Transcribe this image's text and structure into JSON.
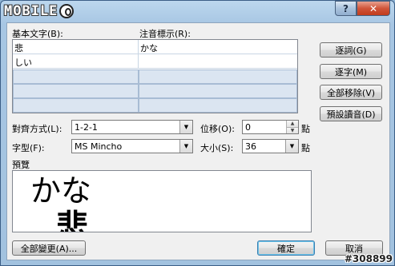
{
  "titlebar": {
    "logo_text": "MOBILE",
    "help_label": "?",
    "close_label": "✕"
  },
  "columns": {
    "base_label": "基本文字(B):",
    "ruby_label": "注音標示(R):"
  },
  "rows": [
    {
      "base": "悲",
      "ruby": "かな"
    },
    {
      "base": "しい",
      "ruby": ""
    }
  ],
  "side_buttons": {
    "group": "逐詞(G)",
    "mono": "逐字(M)",
    "clear": "全部移除(V)",
    "default_reading": "預設讀音(D)"
  },
  "alignment": {
    "label": "對齊方式(L):",
    "value": "1-2-1"
  },
  "offset": {
    "label": "位移(O):",
    "value": "0",
    "unit": "點"
  },
  "font": {
    "label": "字型(F):",
    "value": "MS Mincho"
  },
  "size": {
    "label": "大小(S):",
    "value": "36",
    "unit": "點"
  },
  "preview": {
    "label": "預覽",
    "ruby_text": "かな",
    "base_text": "悲"
  },
  "footer": {
    "apply_all": "全部變更(A)...",
    "ok": "確定",
    "cancel": "取消"
  },
  "watermark": "#308899"
}
